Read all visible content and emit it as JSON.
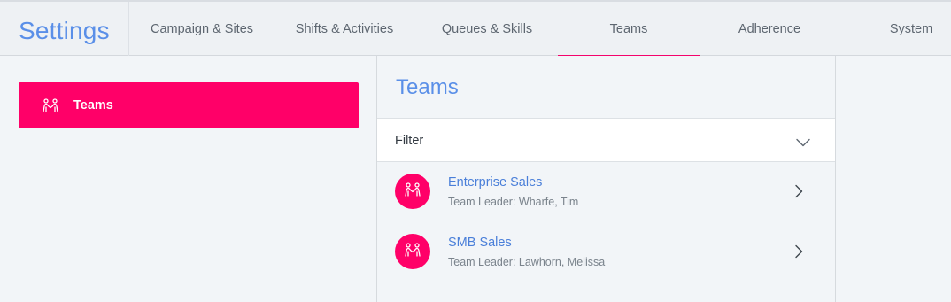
{
  "header": {
    "title": "Settings",
    "tabs": [
      {
        "label": "Campaign & Sites"
      },
      {
        "label": "Shifts & Activities"
      },
      {
        "label": "Queues & Skills"
      },
      {
        "label": "Teams"
      },
      {
        "label": "Adherence"
      },
      {
        "label": "System"
      }
    ],
    "active_tab": "Teams"
  },
  "sidebar": {
    "items": [
      {
        "label": "Teams",
        "icon": "team-icon",
        "active": true
      }
    ]
  },
  "main": {
    "title": "Teams",
    "filter": {
      "label": "Filter",
      "icon": "chevron-down-icon"
    },
    "teams": [
      {
        "name": "Enterprise Sales",
        "leader": "Team Leader: Wharfe, Tim",
        "icon": "team-icon"
      },
      {
        "name": "SMB Sales",
        "leader": "Team Leader: Lawhorn, Melissa",
        "icon": "team-icon"
      }
    ]
  },
  "colors": {
    "accent": "#ff0068",
    "title_blue": "#5a8fe8",
    "link_blue": "#4a7fd9",
    "background": "#f2f5f8"
  }
}
